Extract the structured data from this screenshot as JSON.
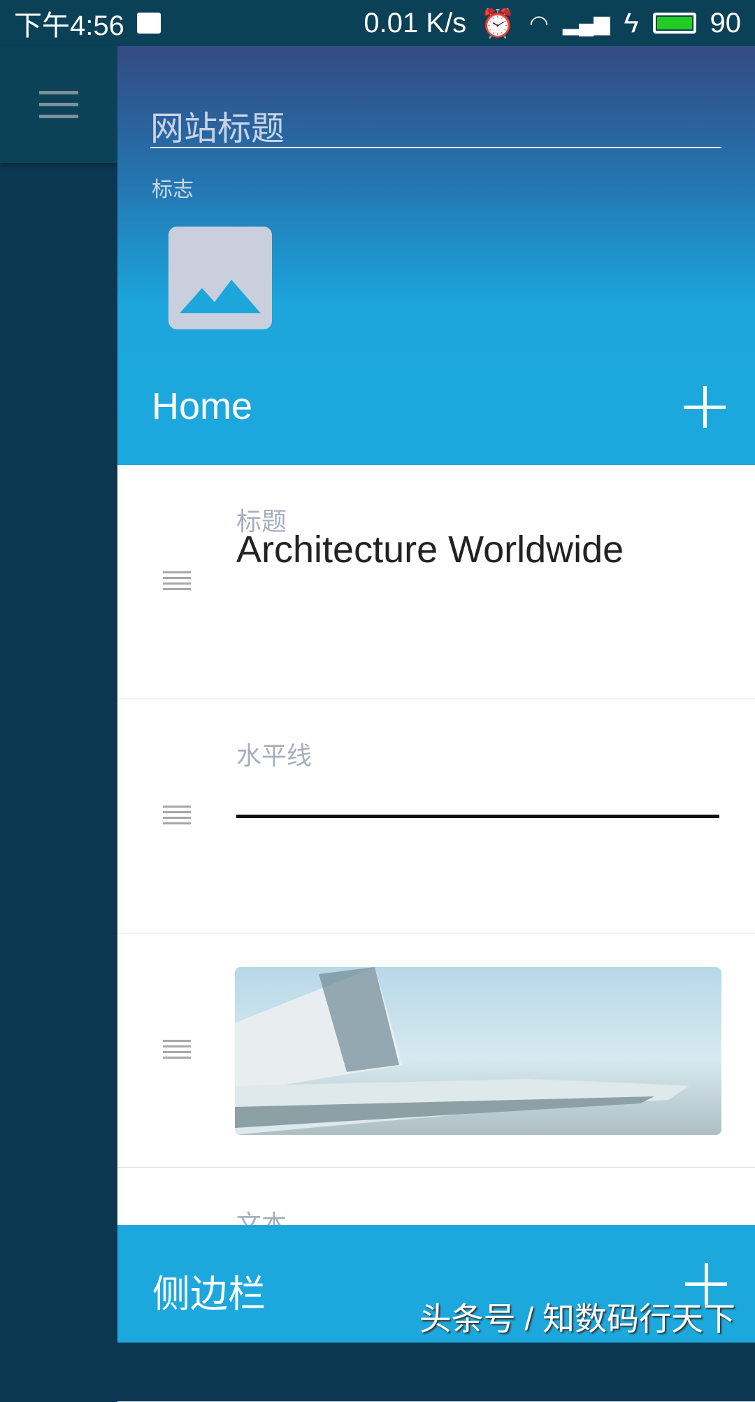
{
  "status": {
    "time": "下午4:56",
    "speed": "0.01 K/s",
    "battery": "90",
    "battery_color": "#22cc22"
  },
  "header": {
    "site_title_placeholder": "网站标题",
    "logo_label": "标志",
    "page_name": "Home"
  },
  "blocks": [
    {
      "label": "标题",
      "value": "Architecture Worldwide"
    },
    {
      "label": "水平线"
    },
    {
      "type": "image"
    },
    {
      "label": "文本"
    }
  ],
  "sidebar_section": {
    "label": "侧边栏"
  },
  "watermark": "头条号 / 知数码行天下"
}
